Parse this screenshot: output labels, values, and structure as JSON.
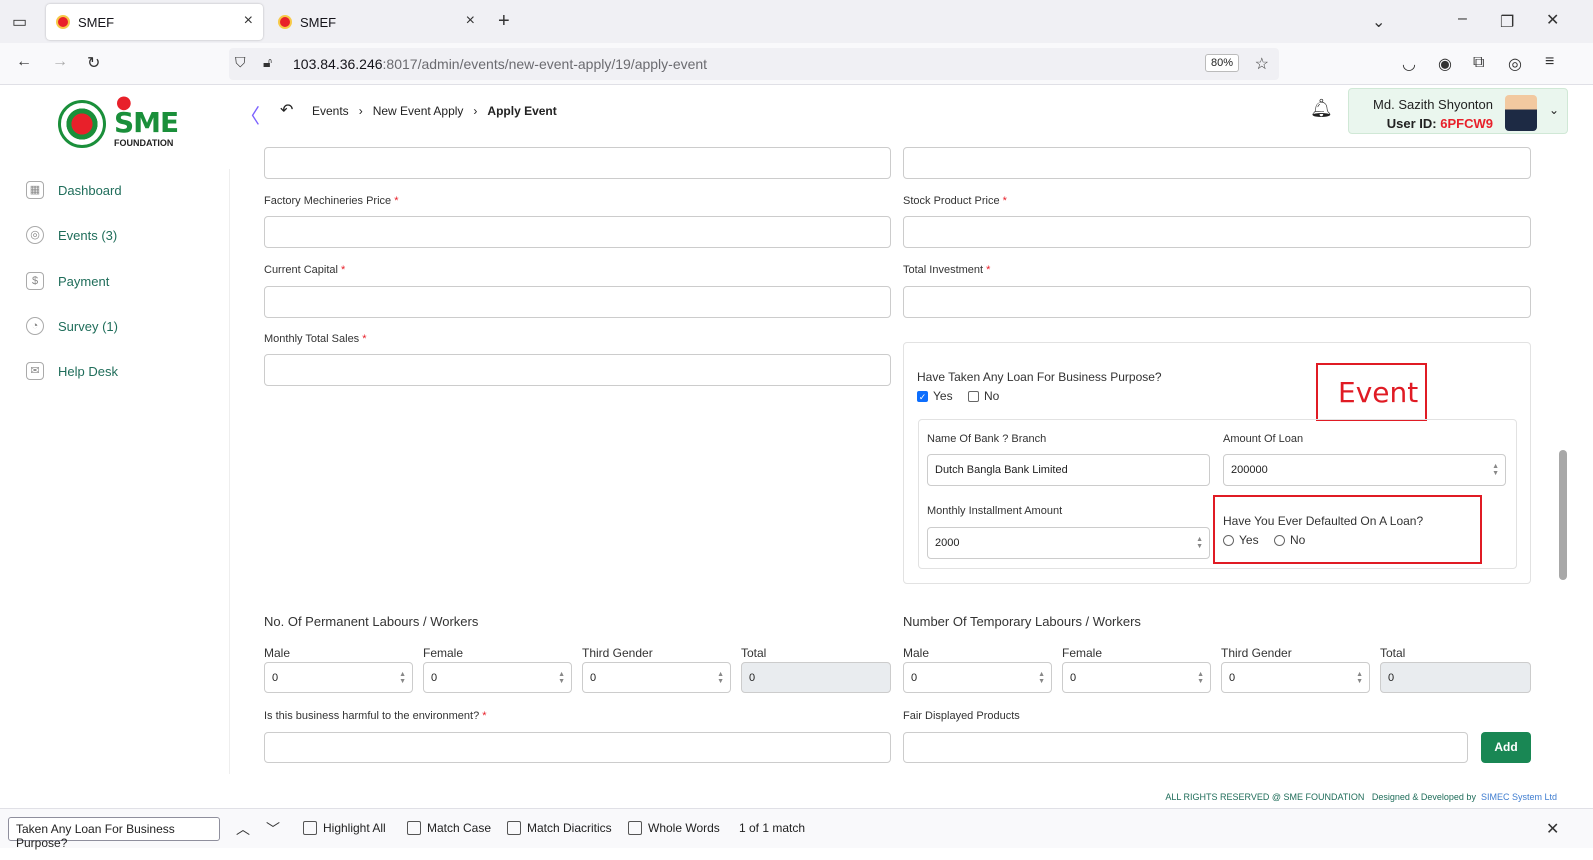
{
  "browser": {
    "tabs": [
      {
        "title": "SMEF"
      },
      {
        "title": "SMEF"
      }
    ],
    "url_host": "103.84.36.246",
    "url_path": ":8017/admin/events/new-event-apply/19/apply-event",
    "zoom": "80%"
  },
  "header": {
    "logo_text": "SME",
    "logo_subtext": "FOUNDATION",
    "breadcrumb": [
      "Events",
      "New Event Apply",
      "Apply Event"
    ],
    "user_name": "Md. Sazith Shyonton",
    "user_id_label": "User ID:",
    "user_id": "6PFCW9"
  },
  "sidebar": {
    "items": [
      {
        "label": "Dashboard",
        "icon": "grid-icon"
      },
      {
        "label": "Events (3)",
        "icon": "events-icon"
      },
      {
        "label": "Payment",
        "icon": "payment-icon"
      },
      {
        "label": "Survey (1)",
        "icon": "pie-icon"
      },
      {
        "label": "Help Desk",
        "icon": "mail-icon"
      }
    ]
  },
  "form": {
    "factory_price_label": "Factory Mechineries Price",
    "stock_price_label": "Stock Product Price",
    "current_capital_label": "Current Capital",
    "total_investment_label": "Total Investment",
    "monthly_sales_label": "Monthly Total Sales",
    "required_mark": "*",
    "loan_question": "Have Taken Any Loan For Business Purpose?",
    "yes": "Yes",
    "no": "No",
    "bank_label": "Name Of Bank ? Branch",
    "bank_value": "Dutch Bangla Bank Limited",
    "loan_amount_label": "Amount Of Loan",
    "loan_amount_value": "200000",
    "installment_label": "Monthly Installment Amount",
    "installment_value": "2000",
    "default_question": "Have You Ever Defaulted On A Loan?",
    "annotation": "Event",
    "permanent_title": "No. Of Permanent Labours / Workers",
    "temporary_title": "Number Of Temporary Labours / Workers",
    "male": "Male",
    "female": "Female",
    "third_gender": "Third Gender",
    "total": "Total",
    "zero": "0",
    "harmful_label": "Is this business harmful to the environment?",
    "fair_products_label": "Fair Displayed Products",
    "add_button": "Add"
  },
  "footer": {
    "rights": "ALL RIGHTS RESERVED @ SME FOUNDATION",
    "designed_by": "Designed & Developed by",
    "company": "SIMEC System Ltd"
  },
  "findbar": {
    "query": "Taken Any Loan For Business Purpose?",
    "highlight_all": "Highlight All",
    "match_case": "Match Case",
    "match_diacritics": "Match Diacritics",
    "whole_words": "Whole Words",
    "result": "1 of 1 match"
  }
}
